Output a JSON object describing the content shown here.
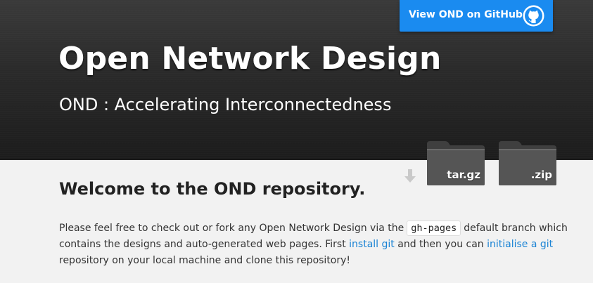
{
  "header": {
    "title": "Open Network Design",
    "tagline": "OND : Accelerating Interconnectedness"
  },
  "github_button": {
    "label": "View OND on GitHub",
    "icon": "github-octocat-icon"
  },
  "downloads": {
    "arrow_icon": "download-arrow-icon",
    "tar_label": "tar.gz",
    "zip_label": ".zip"
  },
  "main": {
    "heading": "Welcome to the OND repository.",
    "para_part1": "Please feel free to check out or fork any Open Network Design via the",
    "code_branch": "gh-pages",
    "para_part2": "default branch which contains the designs and auto-generated web pages. First",
    "link_install": "install git",
    "para_part3": "and then you can",
    "link_init": "initialise a git",
    "para_part4": "repository on your local machine and clone this repository!"
  },
  "colors": {
    "accent": "#1a8bf0",
    "link": "#1a83d4",
    "header_bg": "#262626",
    "page_bg": "#f2f2f2"
  }
}
